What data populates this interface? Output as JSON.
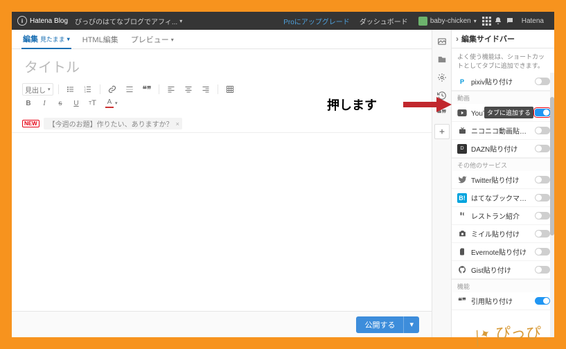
{
  "header": {
    "logo": "Hatena Blog",
    "blog_title": "ぴっぴのはてなブログでアフィ...",
    "pro_link": "Proにアップグレード",
    "dashboard": "ダッシュボード",
    "user": "baby-chicken",
    "brand_right": "Hatena"
  },
  "tabs": {
    "write": "編集",
    "write_mode": "見たまま",
    "html": "HTML編集",
    "preview": "プレビュー"
  },
  "title_placeholder": "タイトル",
  "toolbar": {
    "heading_select": "見出し"
  },
  "tag": {
    "new": "NEW",
    "chip": "【今週のお題】作りたい、ありますか？"
  },
  "footer": {
    "publish": "公開する"
  },
  "sidebar": {
    "title": "編集サイドバー",
    "hint": "よく使う機能は、ショートカットとしてタブに追加できます。",
    "sections": {
      "video": "動画",
      "other": "その他のサービス",
      "function": "機能"
    },
    "items": {
      "pixiv": {
        "label": "pixiv貼り付け",
        "on": false
      },
      "youtube": {
        "label": "YouTube貼り付け",
        "on": true
      },
      "niconico": {
        "label": "ニコニコ動画貼り付け",
        "on": false
      },
      "dazn": {
        "label": "DAZN貼り付け",
        "on": false
      },
      "twitter": {
        "label": "Twitter貼り付け",
        "on": false
      },
      "hatebu": {
        "label": "はてなブックマーク貼り付け",
        "on": false
      },
      "resto": {
        "label": "レストラン紹介",
        "on": false
      },
      "mile": {
        "label": "ミイル貼り付け",
        "on": false
      },
      "evernote": {
        "label": "Evernote貼り付け",
        "on": false
      },
      "gist": {
        "label": "Gist貼り付け",
        "on": false
      },
      "quote": {
        "label": "引用貼り付け",
        "on": true
      }
    },
    "tooltip": "タブに追加する"
  },
  "annotation": {
    "text": "押します",
    "signature": "ぴっぴ"
  }
}
